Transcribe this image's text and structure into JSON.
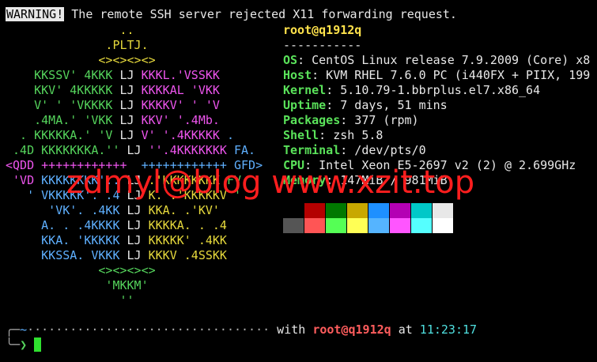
{
  "warning": {
    "badge": "WARNING!",
    "message": " The remote SSH server rejected X11 forwarding request."
  },
  "logo": [
    [
      {
        "t": "                ..",
        "c": "y"
      }
    ],
    [
      {
        "t": "              .PLTJ.",
        "c": "y"
      }
    ],
    [
      {
        "t": "             <><><><>",
        "c": "y"
      }
    ],
    [
      {
        "t": "    KKSSV' 4KKK ",
        "c": "g"
      },
      {
        "t": "LJ",
        "c": "w"
      },
      {
        "t": " KKKL.'VSSKK",
        "c": "m"
      }
    ],
    [
      {
        "t": "    KKV' 4KKKKK ",
        "c": "g"
      },
      {
        "t": "LJ",
        "c": "w"
      },
      {
        "t": " KKKKAL 'VKK",
        "c": "m"
      }
    ],
    [
      {
        "t": "    V' ' 'VKKKK ",
        "c": "g"
      },
      {
        "t": "LJ",
        "c": "w"
      },
      {
        "t": " KKKKV' ' 'V",
        "c": "m"
      }
    ],
    [
      {
        "t": "    .4MA.' 'VKK ",
        "c": "g"
      },
      {
        "t": "LJ",
        "c": "w"
      },
      {
        "t": " KKV' '.4Mb.",
        "c": "m"
      }
    ],
    [
      {
        "t": "  . KKKKKA.' 'V ",
        "c": "g"
      },
      {
        "t": "LJ",
        "c": "w"
      },
      {
        "t": " V' '.4KKKKK ",
        "c": "m"
      },
      {
        "t": ".",
        "c": "b"
      }
    ],
    [
      {
        "t": " .4D KKKKKKKA.'' ",
        "c": "g"
      },
      {
        "t": "LJ",
        "c": "w"
      },
      {
        "t": " ''.4KKKKKKK ",
        "c": "m"
      },
      {
        "t": "FA.",
        "c": "b"
      }
    ],
    [
      {
        "t": "<QDD ",
        "c": "m"
      },
      {
        "t": "++++++++++++  ",
        "c": "m"
      },
      {
        "t": "++++++++++++ ",
        "c": "b"
      },
      {
        "t": "GFD>",
        "c": "b"
      }
    ],
    [
      {
        "t": " 'VD ",
        "c": "m"
      },
      {
        "t": "KKKKKKKK'.. ",
        "c": "b"
      },
      {
        "t": "LJ",
        "c": "w"
      },
      {
        "t": " .'KKKKKKKK ",
        "c": "y"
      },
      {
        "t": "FV",
        "c": "g"
      }
    ],
    [
      {
        "t": "   ' VKKKKK'. .4 ",
        "c": "b"
      },
      {
        "t": "LJ",
        "c": "w"
      },
      {
        "t": " K. .'KKKKKV",
        "c": "y"
      },
      {
        "t": " '",
        "c": "g"
      }
    ],
    [
      {
        "t": "      'VK'. .4KK ",
        "c": "b"
      },
      {
        "t": "LJ",
        "c": "w"
      },
      {
        "t": " KKA. .'KV'",
        "c": "y"
      }
    ],
    [
      {
        "t": "     A. . .4KKKK ",
        "c": "b"
      },
      {
        "t": "LJ",
        "c": "w"
      },
      {
        "t": " KKKKA. . .4",
        "c": "y"
      }
    ],
    [
      {
        "t": "     KKA. 'KKKKK ",
        "c": "b"
      },
      {
        "t": "LJ",
        "c": "w"
      },
      {
        "t": " KKKKK' .4KK",
        "c": "y"
      }
    ],
    [
      {
        "t": "     KKSSA. VKKK ",
        "c": "b"
      },
      {
        "t": "LJ",
        "c": "w"
      },
      {
        "t": " KKKV .4SSKK",
        "c": "y"
      }
    ],
    [
      {
        "t": "             <><><><>",
        "c": "g"
      }
    ],
    [
      {
        "t": "              'MKKM'",
        "c": "g"
      }
    ],
    [
      {
        "t": "                ''",
        "c": "g"
      }
    ]
  ],
  "info": {
    "title": "root@q1912q",
    "separator": "-----------",
    "rows": [
      {
        "key": "OS",
        "value": " CentOS Linux release 7.9.2009 (Core) x8"
      },
      {
        "key": "Host",
        "value": " KVM RHEL 7.6.0 PC (i440FX + PIIX, 199"
      },
      {
        "key": "Kernel",
        "value": " 5.10.79-1.bbrplus.el7.x86_64"
      },
      {
        "key": "Uptime",
        "value": " 7 days, 51 mins"
      },
      {
        "key": "Packages",
        "value": " 377 (rpm)"
      },
      {
        "key": "Shell",
        "value": " zsh 5.8"
      },
      {
        "key": "Terminal",
        "value": " /dev/pts/0"
      },
      {
        "key": "CPU",
        "value": " Intel Xeon E5-2697 v2 (2) @ 2.699GHz"
      },
      {
        "key": "Memory",
        "value": " 147MiB / 981MiB"
      }
    ]
  },
  "palette": {
    "row1": [
      "#000000",
      "#b40000",
      "#007800",
      "#c8a800",
      "#1e90ff",
      "#b400b4",
      "#00c8c8",
      "#e8e8e8"
    ],
    "row2": [
      "#555555",
      "#ff5555",
      "#55ff55",
      "#ffff55",
      "#55b4ff",
      "#ff55ff",
      "#55ffff",
      "#ffffff"
    ]
  },
  "watermark": "zdmyl@blog www.xzit.top",
  "prompt": {
    "tilde": "~",
    "dots": "··································",
    "with": " with ",
    "user": "root@q1912q",
    "at": " at ",
    "time": "11:23:17",
    "arrow": "❯"
  }
}
